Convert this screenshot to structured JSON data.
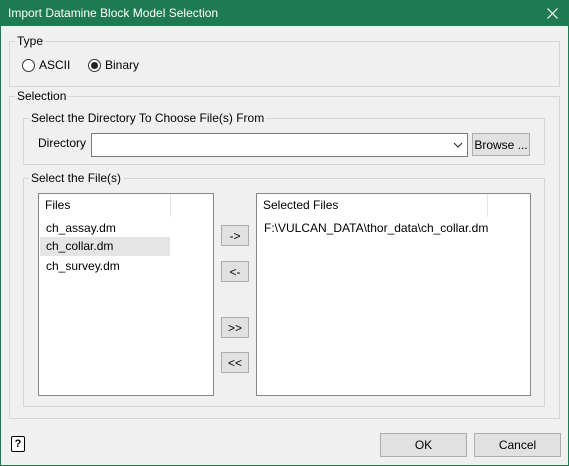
{
  "window": {
    "title": "Import Datamine Block Model Selection",
    "title_bar_color": "#1e7a52"
  },
  "type_group": {
    "label": "Type",
    "options": [
      "ASCII",
      "Binary"
    ],
    "selected": "Binary"
  },
  "selection_group": {
    "label": "Selection",
    "directory_group": {
      "label": "Select the Directory To Choose File(s) From",
      "directory_label": "Directory",
      "directory_value": "",
      "browse_label": "Browse ..."
    },
    "files_group": {
      "label": "Select the File(s)",
      "files_header": "Files",
      "files": [
        "ch_assay.dm",
        "ch_collar.dm",
        "ch_survey.dm"
      ],
      "highlighted_file": "ch_collar.dm",
      "selected_header": "Selected Files",
      "selected_files": [
        "F:\\VULCAN_DATA\\thor_data\\ch_collar.dm"
      ],
      "add_label": "->",
      "remove_label": "<-",
      "add_all_label": ">>",
      "remove_all_label": "<<"
    }
  },
  "footer": {
    "help_label": "?",
    "ok_label": "OK",
    "cancel_label": "Cancel"
  },
  "icons": [
    "close-icon",
    "dropdown-arrow-icon",
    "help-icon"
  ]
}
